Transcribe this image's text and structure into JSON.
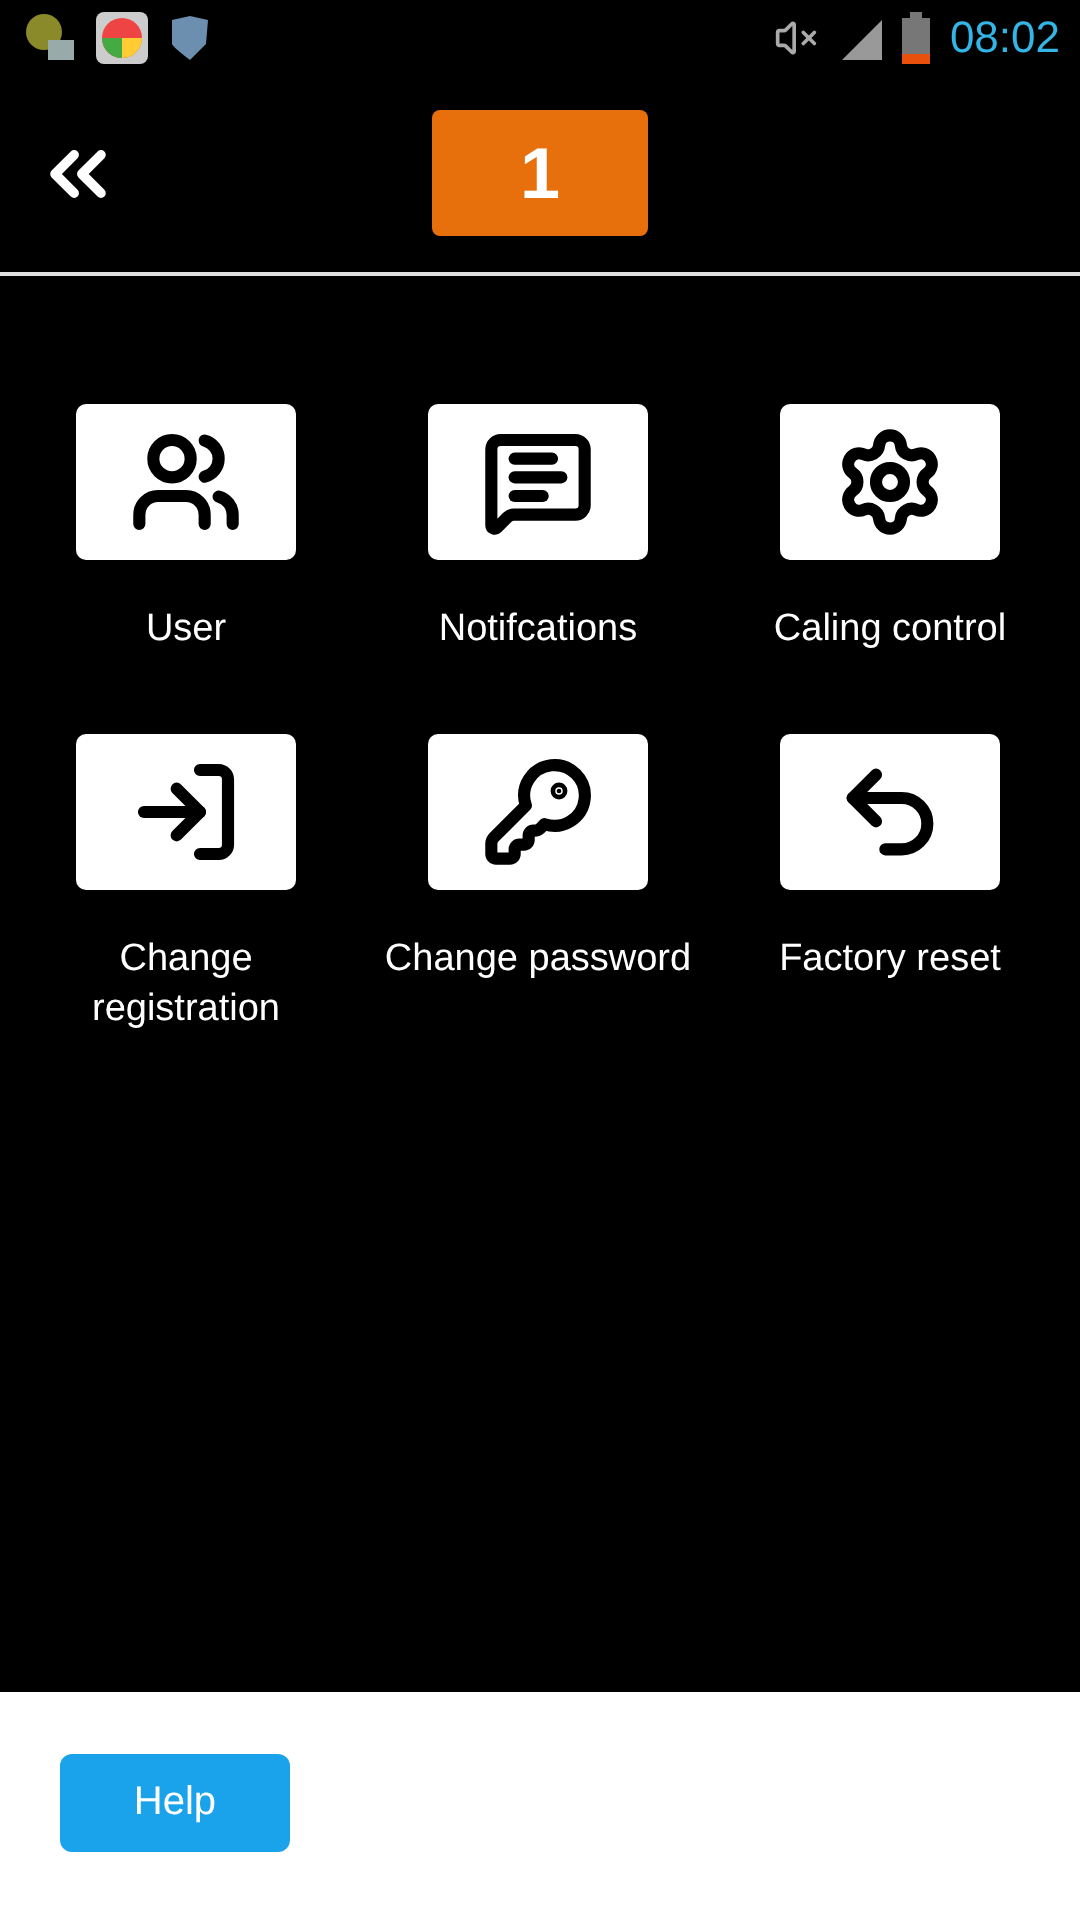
{
  "status_bar": {
    "time": "08:02"
  },
  "header": {
    "badge": "1"
  },
  "tiles": [
    {
      "label": "User"
    },
    {
      "label": "Notifcations"
    },
    {
      "label": "Caling control"
    },
    {
      "label": "Change registration"
    },
    {
      "label": "Change password"
    },
    {
      "label": "Factory reset"
    }
  ],
  "footer": {
    "button": "Help"
  }
}
